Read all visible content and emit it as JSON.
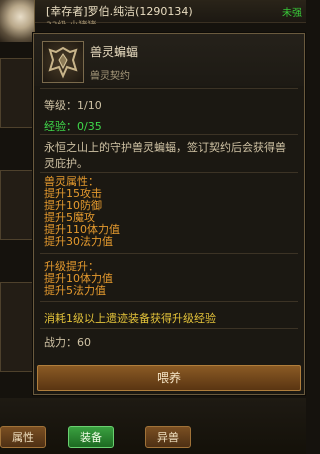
{
  "player": {
    "name": "[幸存者]罗伯.纯洁(1290134)",
    "subline": "33级 小猪猪",
    "right_tag": "未强"
  },
  "tooltip": {
    "item_name": "兽灵蝙蝠",
    "item_type": "兽灵契约",
    "level_label": "等级：1/10",
    "exp_label": "经验：0/35",
    "description": "永恒之山上的守护兽灵蝙蝠，签订契约后会获得兽灵庇护。",
    "attr_title": "兽灵属性：",
    "attrs": [
      "提升15攻击",
      "提升10防御",
      "提升5魔攻",
      "提升110体力值",
      "提升30法力值"
    ],
    "upgrade_title": "升级提升：",
    "upgrade_attrs": [
      "提升10体力值",
      "提升5法力值"
    ],
    "consume_note": "消耗1级以上遗迹装备获得升级经验",
    "power_label": "战力：60",
    "feed_button": "喂养"
  },
  "bottom_tabs": [
    "属性",
    "装备",
    "异兽"
  ]
}
